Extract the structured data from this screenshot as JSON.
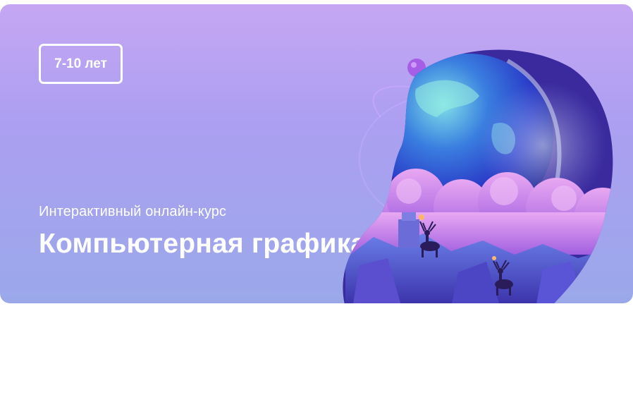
{
  "banner": {
    "age_label": "7-10 лет",
    "subtitle": "Интерактивный онлайн-курс",
    "title": "Компьютерная графика"
  },
  "colors": {
    "gradient_top": "#c5a6f3",
    "gradient_bottom": "#9aa8ea",
    "text": "#ffffff"
  },
  "icons": [
    "planet-landscape-illustration"
  ]
}
